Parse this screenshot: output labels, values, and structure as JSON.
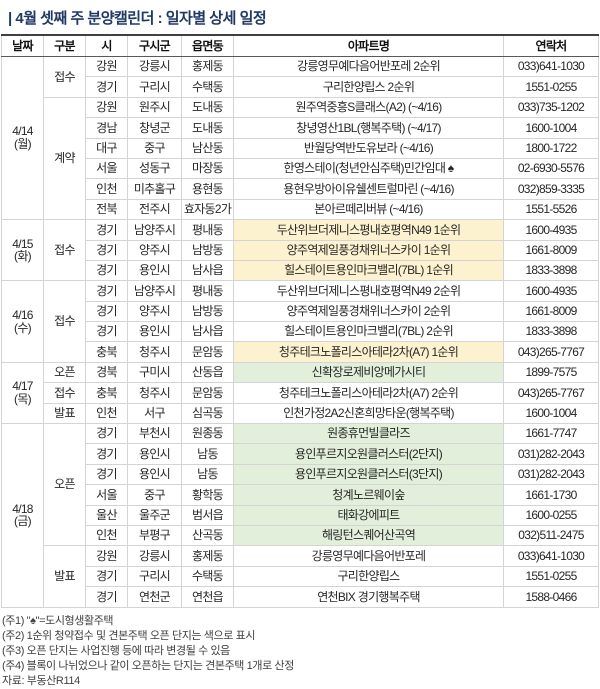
{
  "title": "| 4월 셋째 주 분양캘린더 : 일자별 상세 일정",
  "colors": {
    "title_navy": "#1f3864",
    "highlight_first_rank_yellow": "#fdf2d0",
    "highlight_open_green": "#e2efda"
  },
  "table": {
    "headers": [
      "날짜",
      "구분",
      "시",
      "구시군",
      "읍면동",
      "아파트명",
      "연락처"
    ],
    "groups": [
      {
        "date": "4/14",
        "day": "(월)",
        "sections": [
          {
            "category": "접수",
            "rows": [
              {
                "si": "강원",
                "gu": "강릉시",
                "dong": "홍제동",
                "apt": "강릉영무예다음어반포레 2순위",
                "tel": "033)641-1030",
                "hl": ""
              },
              {
                "si": "경기",
                "gu": "구리시",
                "dong": "수택동",
                "apt": "구리한양립스 2순위",
                "tel": "1551-0255",
                "hl": ""
              }
            ]
          },
          {
            "category": "계약",
            "rows": [
              {
                "si": "강원",
                "gu": "원주시",
                "dong": "도내동",
                "apt": "원주역중흥S클래스(A2) (~4/16)",
                "tel": "033)735-1202",
                "hl": ""
              },
              {
                "si": "경남",
                "gu": "창녕군",
                "dong": "도내동",
                "apt": "창녕영산1BL(행복주택) (~4/17)",
                "tel": "1600-1004",
                "hl": ""
              },
              {
                "si": "대구",
                "gu": "중구",
                "dong": "남산동",
                "apt": "반월당역반도유보라 (~4/16)",
                "tel": "1800-1722",
                "hl": ""
              },
              {
                "si": "서울",
                "gu": "성동구",
                "dong": "마장동",
                "apt": "한영스테이(청년안심주택)민간임대 ♠",
                "tel": "02-6930-5576",
                "hl": ""
              },
              {
                "si": "인천",
                "gu": "미추홀구",
                "dong": "용현동",
                "apt": "용현우방아이유쉘센트럴마린 (~4/16)",
                "tel": "032)859-3335",
                "hl": ""
              },
              {
                "si": "전북",
                "gu": "전주시",
                "dong": "효자동2가",
                "apt": "본아르떼리버뷰 (~4/16)",
                "tel": "1551-5526",
                "hl": ""
              }
            ]
          }
        ]
      },
      {
        "date": "4/15",
        "day": "(화)",
        "sections": [
          {
            "category": "접수",
            "rows": [
              {
                "si": "경기",
                "gu": "남양주시",
                "dong": "평내동",
                "apt": "두산위브더제니스평내호평역N49 1순위",
                "tel": "1600-4935",
                "hl": "yellow"
              },
              {
                "si": "경기",
                "gu": "양주시",
                "dong": "남방동",
                "apt": "양주역제일풍경채위너스카이 1순위",
                "tel": "1661-8009",
                "hl": "yellow"
              },
              {
                "si": "경기",
                "gu": "용인시",
                "dong": "남사읍",
                "apt": "힐스테이트용인마크밸리(7BL) 1순위",
                "tel": "1833-3898",
                "hl": "yellow"
              }
            ]
          }
        ]
      },
      {
        "date": "4/16",
        "day": "(수)",
        "sections": [
          {
            "category": "접수",
            "rows": [
              {
                "si": "경기",
                "gu": "남양주시",
                "dong": "평내동",
                "apt": "두산위브더제니스평내호평역N49 2순위",
                "tel": "1600-4935",
                "hl": ""
              },
              {
                "si": "경기",
                "gu": "양주시",
                "dong": "남방동",
                "apt": "양주역제일풍경채위너스카이 2순위",
                "tel": "1661-8009",
                "hl": ""
              },
              {
                "si": "경기",
                "gu": "용인시",
                "dong": "남사읍",
                "apt": "힐스테이트용인마크밸리(7BL) 2순위",
                "tel": "1833-3898",
                "hl": ""
              },
              {
                "si": "충북",
                "gu": "청주시",
                "dong": "문암동",
                "apt": "청주테크노폴리스아테라2차(A7) 1순위",
                "tel": "043)265-7767",
                "hl": "yellow"
              }
            ]
          }
        ]
      },
      {
        "date": "4/17",
        "day": "(목)",
        "sections": [
          {
            "category": "오픈",
            "rows": [
              {
                "si": "경북",
                "gu": "구미시",
                "dong": "산동읍",
                "apt": "신확장로제비앙메가시티",
                "tel": "1899-7575",
                "hl": "green"
              }
            ]
          },
          {
            "category": "접수",
            "rows": [
              {
                "si": "충북",
                "gu": "청주시",
                "dong": "문암동",
                "apt": "청주테크노폴리스아테라2차(A7) 2순위",
                "tel": "043)265-7767",
                "hl": ""
              }
            ]
          },
          {
            "category": "발표",
            "rows": [
              {
                "si": "인천",
                "gu": "서구",
                "dong": "심곡동",
                "apt": "인천가정2A2신혼희망타운(행복주택)",
                "tel": "1600-1004",
                "hl": ""
              }
            ]
          }
        ]
      },
      {
        "date": "4/18",
        "day": "(금)",
        "sections": [
          {
            "category": "오픈",
            "rows": [
              {
                "si": "경기",
                "gu": "부천시",
                "dong": "원종동",
                "apt": "원종휴먼빌클라즈",
                "tel": "1661-7747",
                "hl": "green"
              },
              {
                "si": "경기",
                "gu": "용인시",
                "dong": "남동",
                "apt": "용인푸르지오원클러스터(2단지)",
                "tel": "031)282-2043",
                "hl": "green"
              },
              {
                "si": "경기",
                "gu": "용인시",
                "dong": "남동",
                "apt": "용인푸르지오원클러스터(3단지)",
                "tel": "031)282-2043",
                "hl": "green"
              },
              {
                "si": "서울",
                "gu": "중구",
                "dong": "황학동",
                "apt": "청계노르웨이숲",
                "tel": "1661-1730",
                "hl": "green"
              },
              {
                "si": "울산",
                "gu": "울주군",
                "dong": "범서읍",
                "apt": "태화강에피트",
                "tel": "1600-0255",
                "hl": "green"
              },
              {
                "si": "인천",
                "gu": "부평구",
                "dong": "산곡동",
                "apt": "해링턴스퀘어산곡역",
                "tel": "032)511-2475",
                "hl": "green"
              }
            ]
          },
          {
            "category": "발표",
            "rows": [
              {
                "si": "강원",
                "gu": "강릉시",
                "dong": "홍제동",
                "apt": "강릉영무예다음어반포레",
                "tel": "033)641-1030",
                "hl": ""
              },
              {
                "si": "경기",
                "gu": "구리시",
                "dong": "수택동",
                "apt": "구리한양립스",
                "tel": "1551-0255",
                "hl": ""
              },
              {
                "si": "경기",
                "gu": "연천군",
                "dong": "연천읍",
                "apt": "연천BIX 경기행복주택",
                "tel": "1588-0466",
                "hl": ""
              }
            ]
          }
        ]
      }
    ]
  },
  "notes": [
    "(주1) \"♠\"=도시형생활주택",
    "(주2) 1순위 청약접수 및 견본주택 오픈 단지는 색으로 표시",
    "(주3) 오픈 단지는 사업진행 등에 따라 변경될 수 있음",
    "(주4) 블록이 나뉘었으나 같이 오픈하는 단지는 견본주택 1개로 산정"
  ],
  "source": "자료: 부동산R114"
}
